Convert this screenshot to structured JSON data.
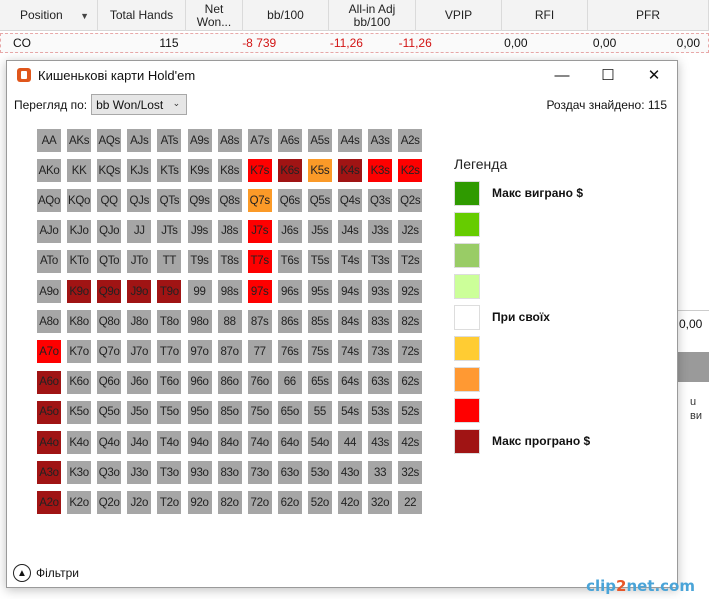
{
  "table": {
    "columns": [
      {
        "label": "Position",
        "width": 98
      },
      {
        "label": "Total Hands",
        "width": 88
      },
      {
        "label": "Net Won...",
        "width": 57
      },
      {
        "label": "bb/100",
        "width": 86
      },
      {
        "label": "All-in Adj bb/100",
        "width": 87
      },
      {
        "label": "VPIP",
        "width": 86
      },
      {
        "label": "RFI",
        "width": 86
      },
      {
        "label": "PFR",
        "width": 121
      }
    ],
    "row": [
      {
        "value": "CO",
        "width": 98,
        "neg": false
      },
      {
        "value": "115",
        "width": 88,
        "neg": false
      },
      {
        "value": "-8 739",
        "width": 98,
        "neg": true
      },
      {
        "value": "-11,26",
        "width": 87,
        "neg": true
      },
      {
        "value": "-11,26",
        "width": 69,
        "neg": true
      },
      {
        "value": "0,00",
        "width": 96,
        "neg": false
      },
      {
        "value": "0,00",
        "width": 89,
        "neg": false
      },
      {
        "value": "0,00",
        "width": 84,
        "neg": false
      }
    ],
    "peek_value": "0,00",
    "peek_text": "u ви"
  },
  "dialog": {
    "title": "Кишенькові карти Hold'em",
    "minimize": "—",
    "maximize": "☐",
    "close": "✕",
    "view_label": "Перегляд по:",
    "view_selected": "bb Won/Lost",
    "found_text": "Роздач знайдено: 115",
    "filters_label": "Фільтри",
    "filters_icon": "▲"
  },
  "colors": {
    "grey": "#a6a6a6",
    "red": "#fe0000",
    "dark_red": "#a01414",
    "orange": "#fb9a28",
    "light_red": "#ff1a1a"
  },
  "grid": [
    [
      "AA",
      "AKs",
      "AQs",
      "AJs",
      "ATs",
      "A9s",
      "A8s",
      "A7s",
      "A6s",
      "A5s",
      "A4s",
      "A3s",
      "A2s"
    ],
    [
      "AKo",
      "KK",
      "KQs",
      "KJs",
      "KTs",
      "K9s",
      "K8s",
      "K7s",
      "K6s",
      "K5s",
      "K4s",
      "K3s",
      "K2s"
    ],
    [
      "AQo",
      "KQo",
      "QQ",
      "QJs",
      "QTs",
      "Q9s",
      "Q8s",
      "Q7s",
      "Q6s",
      "Q5s",
      "Q4s",
      "Q3s",
      "Q2s"
    ],
    [
      "AJo",
      "KJo",
      "QJo",
      "JJ",
      "JTs",
      "J9s",
      "J8s",
      "J7s",
      "J6s",
      "J5s",
      "J4s",
      "J3s",
      "J2s"
    ],
    [
      "ATo",
      "KTo",
      "QTo",
      "JTo",
      "TT",
      "T9s",
      "T8s",
      "T7s",
      "T6s",
      "T5s",
      "T4s",
      "T3s",
      "T2s"
    ],
    [
      "A9o",
      "K9o",
      "Q9o",
      "J9o",
      "T9o",
      "99",
      "98s",
      "97s",
      "96s",
      "95s",
      "94s",
      "93s",
      "92s"
    ],
    [
      "A8o",
      "K8o",
      "Q8o",
      "J8o",
      "T8o",
      "98o",
      "88",
      "87s",
      "86s",
      "85s",
      "84s",
      "83s",
      "82s"
    ],
    [
      "A7o",
      "K7o",
      "Q7o",
      "J7o",
      "T7o",
      "97o",
      "87o",
      "77",
      "76s",
      "75s",
      "74s",
      "73s",
      "72s"
    ],
    [
      "A6o",
      "K6o",
      "Q6o",
      "J6o",
      "T6o",
      "96o",
      "86o",
      "76o",
      "66",
      "65s",
      "64s",
      "63s",
      "62s"
    ],
    [
      "A5o",
      "K5o",
      "Q5o",
      "J5o",
      "T5o",
      "95o",
      "85o",
      "75o",
      "65o",
      "55",
      "54s",
      "53s",
      "52s"
    ],
    [
      "A4o",
      "K4o",
      "Q4o",
      "J4o",
      "T4o",
      "94o",
      "84o",
      "74o",
      "64o",
      "54o",
      "44",
      "43s",
      "42s"
    ],
    [
      "A3o",
      "K3o",
      "Q3o",
      "J3o",
      "T3o",
      "93o",
      "83o",
      "73o",
      "63o",
      "53o",
      "43o",
      "33",
      "32s"
    ],
    [
      "A2o",
      "K2o",
      "Q2o",
      "J2o",
      "T2o",
      "92o",
      "82o",
      "72o",
      "62o",
      "52o",
      "42o",
      "32o",
      "22"
    ]
  ],
  "cell_colors": {
    "K7s": "#fe0000",
    "K6s": "#a01414",
    "K5s": "#fb9a28",
    "K4s": "#a01414",
    "K3s": "#fe0000",
    "K2s": "#fe0000",
    "Q7s": "#fb9a28",
    "J7s": "#fe0000",
    "T7s": "#fe0000",
    "K9o": "#a01414",
    "Q9o": "#a01414",
    "J9o": "#a01414",
    "T9o": "#a01414",
    "97s": "#fe0000",
    "A7o": "#fe0000",
    "A6o": "#a01414",
    "A5o": "#a01414",
    "A4o": "#a01414",
    "A3o": "#a01414",
    "A2o": "#a01414"
  },
  "legend": {
    "title": "Легенда",
    "items": [
      {
        "color": "#2f9a00",
        "label": "Макс виграно $"
      },
      {
        "color": "#66cc00",
        "label": ""
      },
      {
        "color": "#99cc66",
        "label": ""
      },
      {
        "color": "#ccff99",
        "label": ""
      },
      {
        "color": "#ffffff",
        "label": "При своїх"
      },
      {
        "color": "#ffcc33",
        "label": ""
      },
      {
        "color": "#ff9933",
        "label": ""
      },
      {
        "color": "#ff0000",
        "label": ""
      },
      {
        "color": "#a01414",
        "label": "Макс програно $"
      }
    ]
  },
  "watermark": {
    "pre": "clip",
    "two": "2",
    "post": "net.com"
  }
}
